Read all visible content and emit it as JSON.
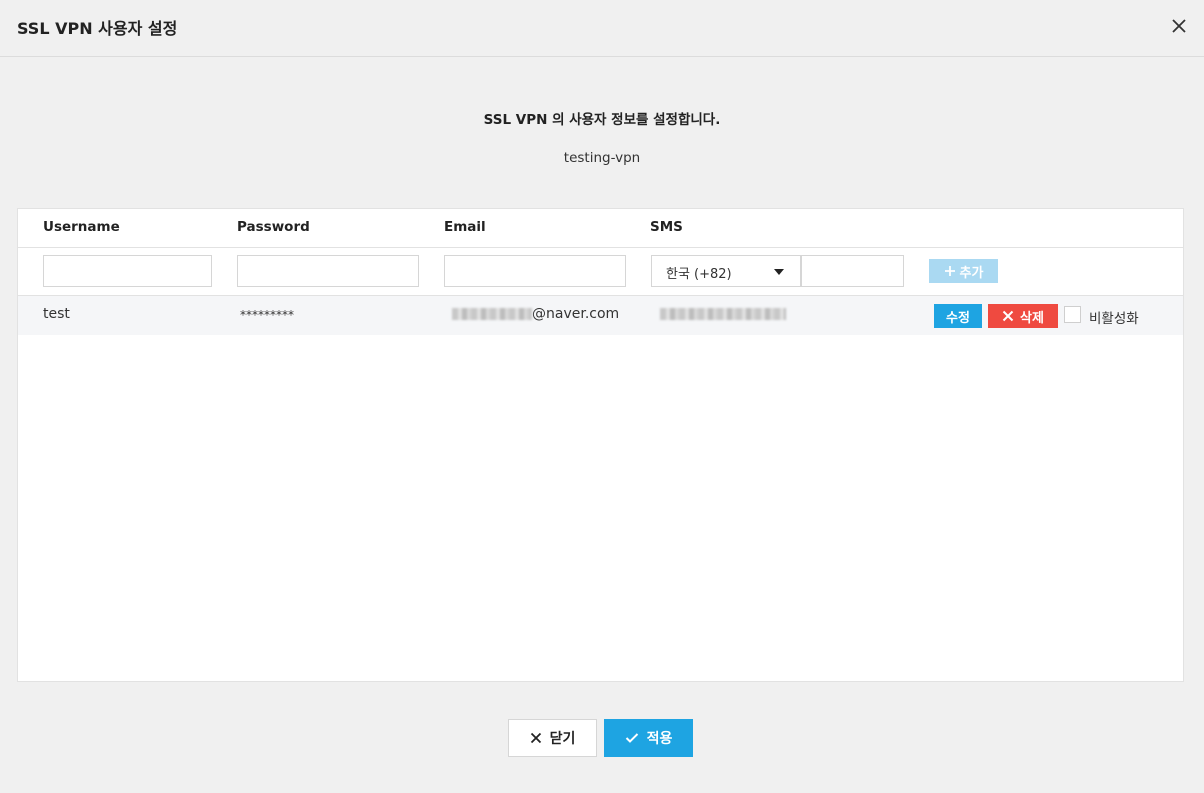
{
  "dialog": {
    "title": "SSL VPN 사용자 설정",
    "description": "SSL VPN 의 사용자 정보를 설정합니다.",
    "vpn_name": "testing-vpn"
  },
  "table": {
    "columns": [
      "Username",
      "Password",
      "Email",
      "SMS"
    ],
    "new_row": {
      "country_select": "한국 (+82)",
      "add_label": "추가"
    },
    "rows": [
      {
        "username": "test",
        "password": "*********",
        "email_visible": "@naver.com",
        "edit_label": "수정",
        "delete_label": "삭제",
        "disable_label": "비활성화"
      }
    ]
  },
  "footer": {
    "close_label": "닫기",
    "apply_label": "적용"
  },
  "colors": {
    "primary": "#1ea4e2",
    "danger": "#ef4a40",
    "primary_disabled": "#aad9f2"
  }
}
